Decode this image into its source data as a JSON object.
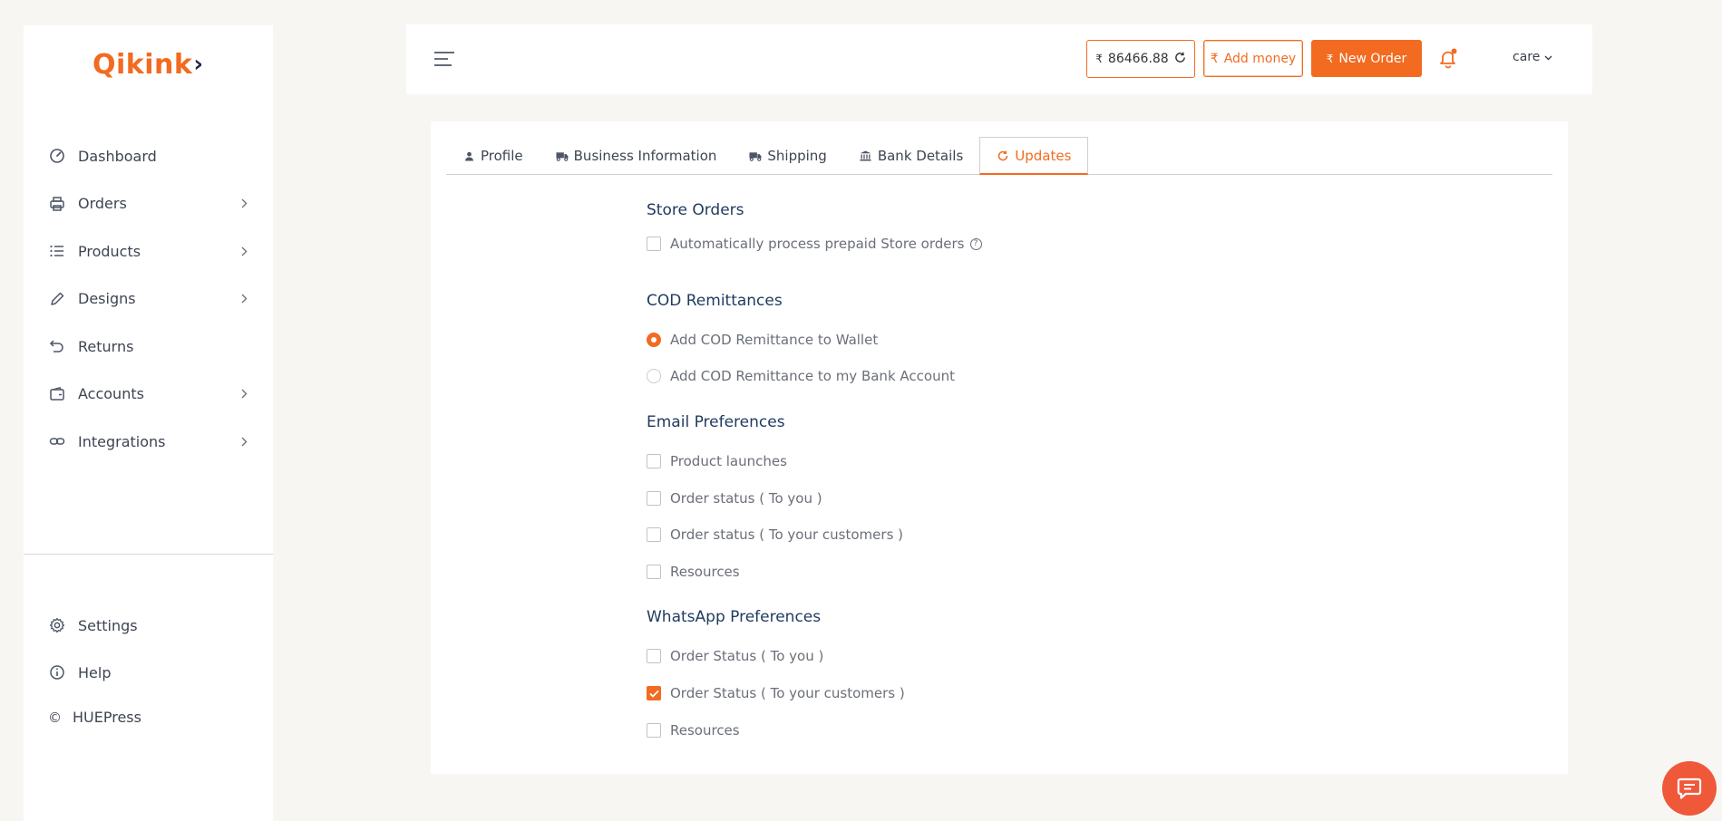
{
  "brand": {
    "logo_text": "Qikink",
    "accent": "#f26b21"
  },
  "sidebar": {
    "items": [
      {
        "label": "Dashboard",
        "icon": "gauge-icon",
        "has_children": false
      },
      {
        "label": "Orders",
        "icon": "printer-icon",
        "has_children": true
      },
      {
        "label": "Products",
        "icon": "list-icon",
        "has_children": true
      },
      {
        "label": "Designs",
        "icon": "pencil-icon",
        "has_children": true
      },
      {
        "label": "Returns",
        "icon": "undo-icon",
        "has_children": false
      },
      {
        "label": "Accounts",
        "icon": "wallet-icon",
        "has_children": true
      },
      {
        "label": "Integrations",
        "icon": "link-icon",
        "has_children": true
      }
    ],
    "bottom_items": [
      {
        "label": "Settings",
        "icon": "gear-icon"
      },
      {
        "label": "Help",
        "icon": "info-icon"
      }
    ],
    "copyright_symbol": "©",
    "copyright_text": "HUEPress"
  },
  "topbar": {
    "currency_symbol": "₹",
    "wallet_balance": "86466.88",
    "add_money_label": "Add money",
    "new_order_label": "New Order",
    "user_name": "care"
  },
  "tabs": [
    {
      "label": "Profile",
      "icon": "user-icon",
      "active": false
    },
    {
      "label": "Business Information",
      "icon": "truck-icon",
      "active": false
    },
    {
      "label": "Shipping",
      "icon": "shipping-truck-icon",
      "active": false
    },
    {
      "label": "Bank Details",
      "icon": "bank-icon",
      "active": false
    },
    {
      "label": "Updates",
      "icon": "refresh-icon",
      "active": true
    }
  ],
  "sections": {
    "store_orders": {
      "title": "Store Orders",
      "auto_process_label": "Automatically process prepaid Store orders",
      "auto_process_checked": false
    },
    "cod": {
      "title": "COD Remittances",
      "wallet_label": "Add COD Remittance to Wallet",
      "bank_label": "Add COD Remittance to my Bank Account",
      "selected": "wallet"
    },
    "email": {
      "title": "Email Preferences",
      "options": [
        {
          "label": "Product launches",
          "checked": false
        },
        {
          "label": "Order status ( To you )",
          "checked": false
        },
        {
          "label": "Order status ( To your customers )",
          "checked": false
        },
        {
          "label": "Resources",
          "checked": false
        }
      ]
    },
    "whatsapp": {
      "title": "WhatsApp Preferences",
      "options": [
        {
          "label": "Order Status ( To you )",
          "checked": false
        },
        {
          "label": "Order Status ( To your customers )",
          "checked": true
        },
        {
          "label": "Resources",
          "checked": false
        }
      ]
    }
  }
}
